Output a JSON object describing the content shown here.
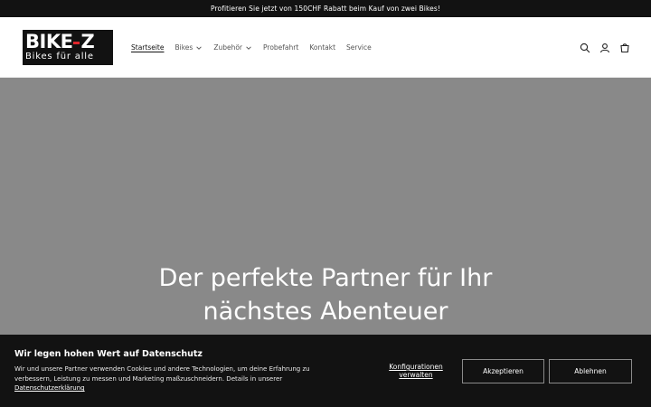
{
  "announcement": {
    "text": "Profitieren Sie jetzt von 150CHF Rabatt beim Kauf von zwei Bikes!"
  },
  "logo": {
    "brand_left": "BIKE",
    "brand_right": "Z",
    "tagline": "Bikes für alle",
    "accent_color": "#e0262b"
  },
  "nav": {
    "items": [
      {
        "label": "Startseite",
        "active": true
      },
      {
        "label": "Bikes",
        "has_dropdown": true
      },
      {
        "label": "Zubehör",
        "has_dropdown": true
      },
      {
        "label": "Probefahrt"
      },
      {
        "label": "Kontakt"
      },
      {
        "label": "Service"
      }
    ]
  },
  "header_icons": [
    "search-icon",
    "account-icon",
    "cart-icon"
  ],
  "hero": {
    "title_line1": "Der perfekte Partner für Ihr",
    "title_line2": "nächstes Abenteuer",
    "background_color": "#898989"
  },
  "cookie_banner": {
    "title": "Wir legen hohen Wert auf Datenschutz",
    "text": "Wir und unsere Partner verwenden Cookies und andere Technologien, um deine Erfahrung zu verbessern, Leistung zu messen und Marketing maßzuschneidern. Details in unserer",
    "link": "Datenschutzerklärung",
    "config_label": "Konfigurationen verwalten",
    "accept_label": "Akzeptieren",
    "decline_label": "Ablehnen"
  }
}
